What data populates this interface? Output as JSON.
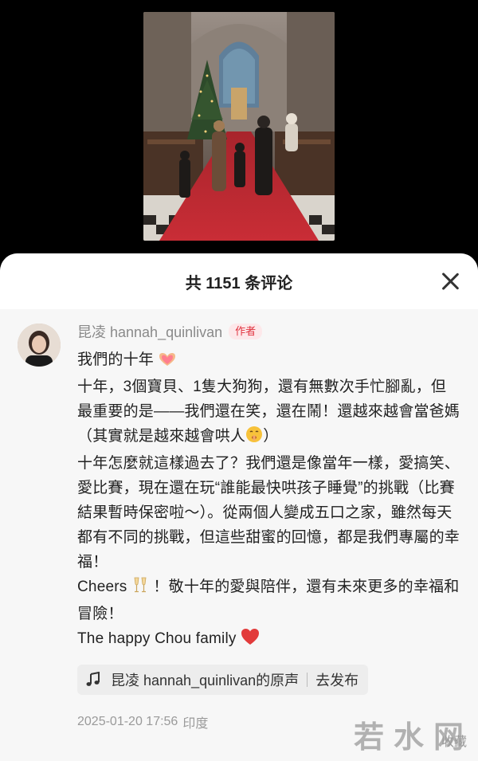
{
  "header": {
    "title": "共 1151 条评论"
  },
  "comment": {
    "author": "昆凌 hannah_quinlivan",
    "author_tag": "作者",
    "line1": "我們的十年",
    "paragraph1": "十年，3個寶貝、1隻大狗狗，還有無數次手忙腳亂，但最重要的是——我們還在笑，還在鬧！還越來越會當爸媽（其實就是越來越會哄人",
    "paragraph1_end": "）",
    "paragraph2": "十年怎麼就這樣過去了？我們還是像當年一樣，愛搞笑、愛比賽，現在還在玩“誰能最快哄孩子睡覺”的挑戰（比賽結果暫時保密啦～）。從兩個人變成五口之家，雖然每天都有不同的挑戰，但這些甜蜜的回憶，都是我們專屬的幸福！",
    "paragraph3_start": "Cheers",
    "paragraph3_end": "！敬十年的愛與陪伴，還有未來更多的幸福和冒險！",
    "paragraph4": "The happy Chou family",
    "sound_label": "昆凌 hannah_quinlivan的原声",
    "sound_action": "去发布",
    "timestamp": "2025-01-20 17:56",
    "location": "印度"
  },
  "watermark": {
    "text": "若水网",
    "trailing": "收藏"
  },
  "colors": {
    "tag_red": "#e0303c",
    "heart": "#e23b3b",
    "sheet_bg": "#f7f7f7"
  },
  "icons": [
    "close-icon",
    "heart-hands-icon",
    "shush-face-icon",
    "champagne-icon",
    "red-heart-icon",
    "music-note-icon"
  ]
}
